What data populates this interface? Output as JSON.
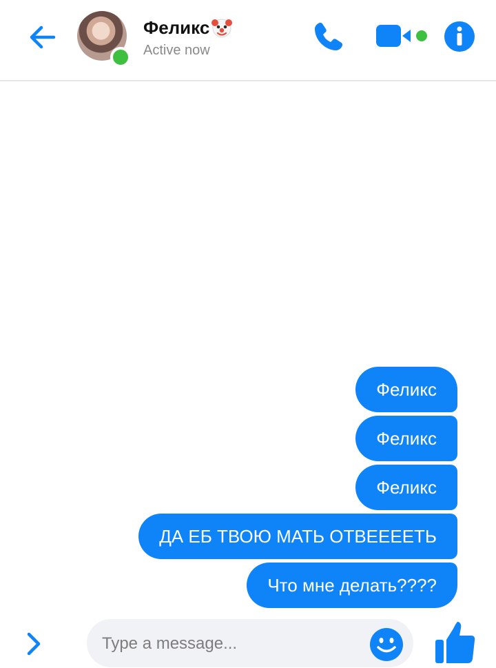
{
  "header": {
    "contact_name": "Феликс",
    "status": "Active now",
    "accent_color": "#0f84f8",
    "online_color": "#3fbf3f",
    "icons": [
      "back-arrow-icon",
      "avatar",
      "clown-face-icon",
      "phone-icon",
      "video-camera-icon",
      "info-icon"
    ]
  },
  "messages": [
    {
      "text": "Феликс",
      "direction": "outgoing"
    },
    {
      "text": "Феликс",
      "direction": "outgoing"
    },
    {
      "text": "Феликс",
      "direction": "outgoing"
    },
    {
      "text": "ДА ЕБ ТВОЮ МАТЬ ОТВЕЕЕЕТЬ",
      "direction": "outgoing"
    },
    {
      "text": "Что мне делать????",
      "direction": "outgoing"
    }
  ],
  "composer": {
    "placeholder": "Type a message...",
    "icons": [
      "chevron-right-icon",
      "smiley-icon",
      "thumbs-up-icon"
    ]
  }
}
